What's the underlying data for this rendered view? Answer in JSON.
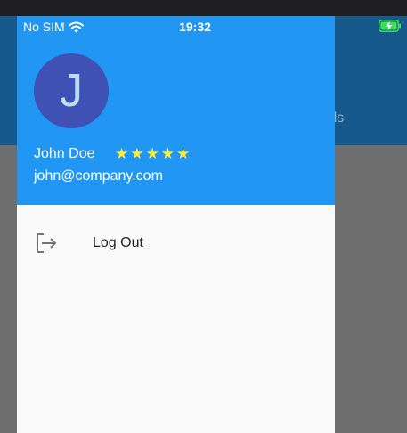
{
  "status_bar": {
    "carrier": "No SIM",
    "time": "19:32"
  },
  "backdrop": {
    "tab_fragment": "entials"
  },
  "drawer": {
    "avatar_letter": "J",
    "user_name": "John Doe",
    "rating": 5,
    "star_glyph": "★",
    "user_email": "john@company.com",
    "menu": [
      {
        "label": "Log Out",
        "icon": "logout-icon"
      }
    ]
  },
  "colors": {
    "header": "#2196f3",
    "avatar_bg": "#3f51b5",
    "star": "#ffeb3b",
    "backdrop_appbar": "#155a8a",
    "scrim": "#6e6e6e"
  }
}
